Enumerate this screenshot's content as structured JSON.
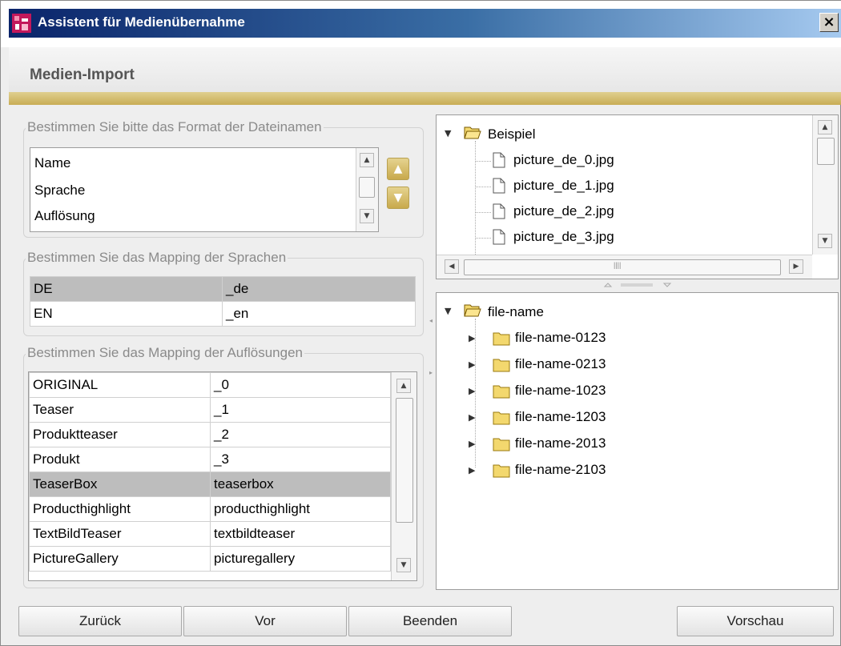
{
  "window": {
    "title": "Assistent für Medienübernahme",
    "close_symbol": "×"
  },
  "header": {
    "title": "Medien-Import"
  },
  "format_group": {
    "legend": "Bestimmen Sie bitte das Format der Dateinamen",
    "items": [
      "Name",
      "Sprache",
      "Auflösung"
    ],
    "up_symbol": "▲",
    "down_symbol": "▼"
  },
  "language_group": {
    "legend": "Bestimmen Sie das Mapping der Sprachen",
    "rows": [
      {
        "lang": "DE",
        "suffix": "_de",
        "selected": true
      },
      {
        "lang": "EN",
        "suffix": "_en",
        "selected": false
      }
    ]
  },
  "resolution_group": {
    "legend": "Bestimmen Sie das Mapping der Auflösungen",
    "rows": [
      {
        "name": "ORIGINAL",
        "suffix": "_0",
        "selected": false
      },
      {
        "name": "Teaser",
        "suffix": "_1",
        "selected": false
      },
      {
        "name": "Produktteaser",
        "suffix": "_2",
        "selected": false
      },
      {
        "name": "Produkt",
        "suffix": "_3",
        "selected": false
      },
      {
        "name": "TeaserBox",
        "suffix": "teaserbox",
        "selected": true
      },
      {
        "name": "Producthighlight",
        "suffix": "producthighlight",
        "selected": false
      },
      {
        "name": "TextBildTeaser",
        "suffix": "textbildteaser",
        "selected": false
      },
      {
        "name": "PictureGallery",
        "suffix": "picturegallery",
        "selected": false
      }
    ]
  },
  "example_tree": {
    "root": "Beispiel",
    "children": [
      "picture_de_0.jpg",
      "picture_de_1.jpg",
      "picture_de_2.jpg",
      "picture_de_3.jpg"
    ],
    "hscroll_grip": "||||"
  },
  "filename_tree": {
    "root": "file-name",
    "children": [
      "file-name-0123",
      "file-name-0213",
      "file-name-1023",
      "file-name-1203",
      "file-name-2013",
      "file-name-2103"
    ]
  },
  "buttons": {
    "back": "Zurück",
    "next": "Vor",
    "finish": "Beenden",
    "preview": "Vorschau"
  },
  "colors": {
    "title_bar_start": "#0a246a",
    "accent_gold": "#c8ad55",
    "selection_gray": "#bdbdbd",
    "folder_yellow": "#f3d86e"
  }
}
